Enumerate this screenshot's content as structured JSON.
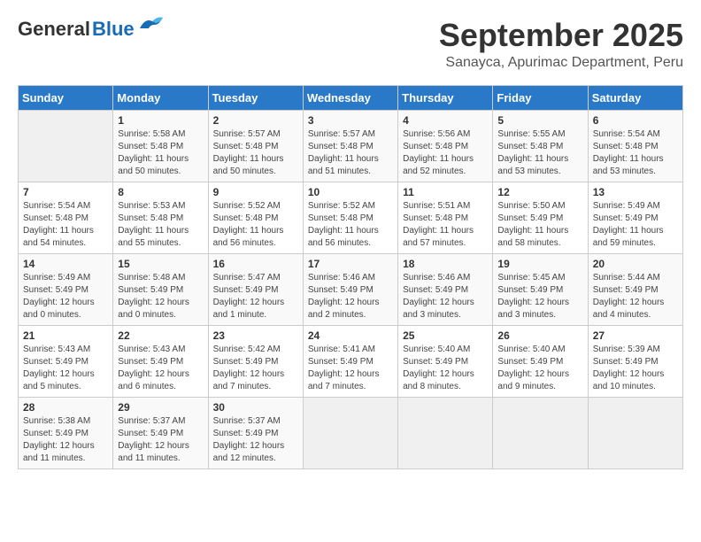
{
  "header": {
    "logo_general": "General",
    "logo_blue": "Blue",
    "title": "September 2025",
    "location": "Sanayca, Apurimac Department, Peru"
  },
  "days_of_week": [
    "Sunday",
    "Monday",
    "Tuesday",
    "Wednesday",
    "Thursday",
    "Friday",
    "Saturday"
  ],
  "weeks": [
    [
      {
        "day": "",
        "info": ""
      },
      {
        "day": "1",
        "info": "Sunrise: 5:58 AM\nSunset: 5:48 PM\nDaylight: 11 hours\nand 50 minutes."
      },
      {
        "day": "2",
        "info": "Sunrise: 5:57 AM\nSunset: 5:48 PM\nDaylight: 11 hours\nand 50 minutes."
      },
      {
        "day": "3",
        "info": "Sunrise: 5:57 AM\nSunset: 5:48 PM\nDaylight: 11 hours\nand 51 minutes."
      },
      {
        "day": "4",
        "info": "Sunrise: 5:56 AM\nSunset: 5:48 PM\nDaylight: 11 hours\nand 52 minutes."
      },
      {
        "day": "5",
        "info": "Sunrise: 5:55 AM\nSunset: 5:48 PM\nDaylight: 11 hours\nand 53 minutes."
      },
      {
        "day": "6",
        "info": "Sunrise: 5:54 AM\nSunset: 5:48 PM\nDaylight: 11 hours\nand 53 minutes."
      }
    ],
    [
      {
        "day": "7",
        "info": "Sunrise: 5:54 AM\nSunset: 5:48 PM\nDaylight: 11 hours\nand 54 minutes."
      },
      {
        "day": "8",
        "info": "Sunrise: 5:53 AM\nSunset: 5:48 PM\nDaylight: 11 hours\nand 55 minutes."
      },
      {
        "day": "9",
        "info": "Sunrise: 5:52 AM\nSunset: 5:48 PM\nDaylight: 11 hours\nand 56 minutes."
      },
      {
        "day": "10",
        "info": "Sunrise: 5:52 AM\nSunset: 5:48 PM\nDaylight: 11 hours\nand 56 minutes."
      },
      {
        "day": "11",
        "info": "Sunrise: 5:51 AM\nSunset: 5:48 PM\nDaylight: 11 hours\nand 57 minutes."
      },
      {
        "day": "12",
        "info": "Sunrise: 5:50 AM\nSunset: 5:49 PM\nDaylight: 11 hours\nand 58 minutes."
      },
      {
        "day": "13",
        "info": "Sunrise: 5:49 AM\nSunset: 5:49 PM\nDaylight: 11 hours\nand 59 minutes."
      }
    ],
    [
      {
        "day": "14",
        "info": "Sunrise: 5:49 AM\nSunset: 5:49 PM\nDaylight: 12 hours\nand 0 minutes."
      },
      {
        "day": "15",
        "info": "Sunrise: 5:48 AM\nSunset: 5:49 PM\nDaylight: 12 hours\nand 0 minutes."
      },
      {
        "day": "16",
        "info": "Sunrise: 5:47 AM\nSunset: 5:49 PM\nDaylight: 12 hours\nand 1 minute."
      },
      {
        "day": "17",
        "info": "Sunrise: 5:46 AM\nSunset: 5:49 PM\nDaylight: 12 hours\nand 2 minutes."
      },
      {
        "day": "18",
        "info": "Sunrise: 5:46 AM\nSunset: 5:49 PM\nDaylight: 12 hours\nand 3 minutes."
      },
      {
        "day": "19",
        "info": "Sunrise: 5:45 AM\nSunset: 5:49 PM\nDaylight: 12 hours\nand 3 minutes."
      },
      {
        "day": "20",
        "info": "Sunrise: 5:44 AM\nSunset: 5:49 PM\nDaylight: 12 hours\nand 4 minutes."
      }
    ],
    [
      {
        "day": "21",
        "info": "Sunrise: 5:43 AM\nSunset: 5:49 PM\nDaylight: 12 hours\nand 5 minutes."
      },
      {
        "day": "22",
        "info": "Sunrise: 5:43 AM\nSunset: 5:49 PM\nDaylight: 12 hours\nand 6 minutes."
      },
      {
        "day": "23",
        "info": "Sunrise: 5:42 AM\nSunset: 5:49 PM\nDaylight: 12 hours\nand 7 minutes."
      },
      {
        "day": "24",
        "info": "Sunrise: 5:41 AM\nSunset: 5:49 PM\nDaylight: 12 hours\nand 7 minutes."
      },
      {
        "day": "25",
        "info": "Sunrise: 5:40 AM\nSunset: 5:49 PM\nDaylight: 12 hours\nand 8 minutes."
      },
      {
        "day": "26",
        "info": "Sunrise: 5:40 AM\nSunset: 5:49 PM\nDaylight: 12 hours\nand 9 minutes."
      },
      {
        "day": "27",
        "info": "Sunrise: 5:39 AM\nSunset: 5:49 PM\nDaylight: 12 hours\nand 10 minutes."
      }
    ],
    [
      {
        "day": "28",
        "info": "Sunrise: 5:38 AM\nSunset: 5:49 PM\nDaylight: 12 hours\nand 11 minutes."
      },
      {
        "day": "29",
        "info": "Sunrise: 5:37 AM\nSunset: 5:49 PM\nDaylight: 12 hours\nand 11 minutes."
      },
      {
        "day": "30",
        "info": "Sunrise: 5:37 AM\nSunset: 5:49 PM\nDaylight: 12 hours\nand 12 minutes."
      },
      {
        "day": "",
        "info": ""
      },
      {
        "day": "",
        "info": ""
      },
      {
        "day": "",
        "info": ""
      },
      {
        "day": "",
        "info": ""
      }
    ]
  ]
}
